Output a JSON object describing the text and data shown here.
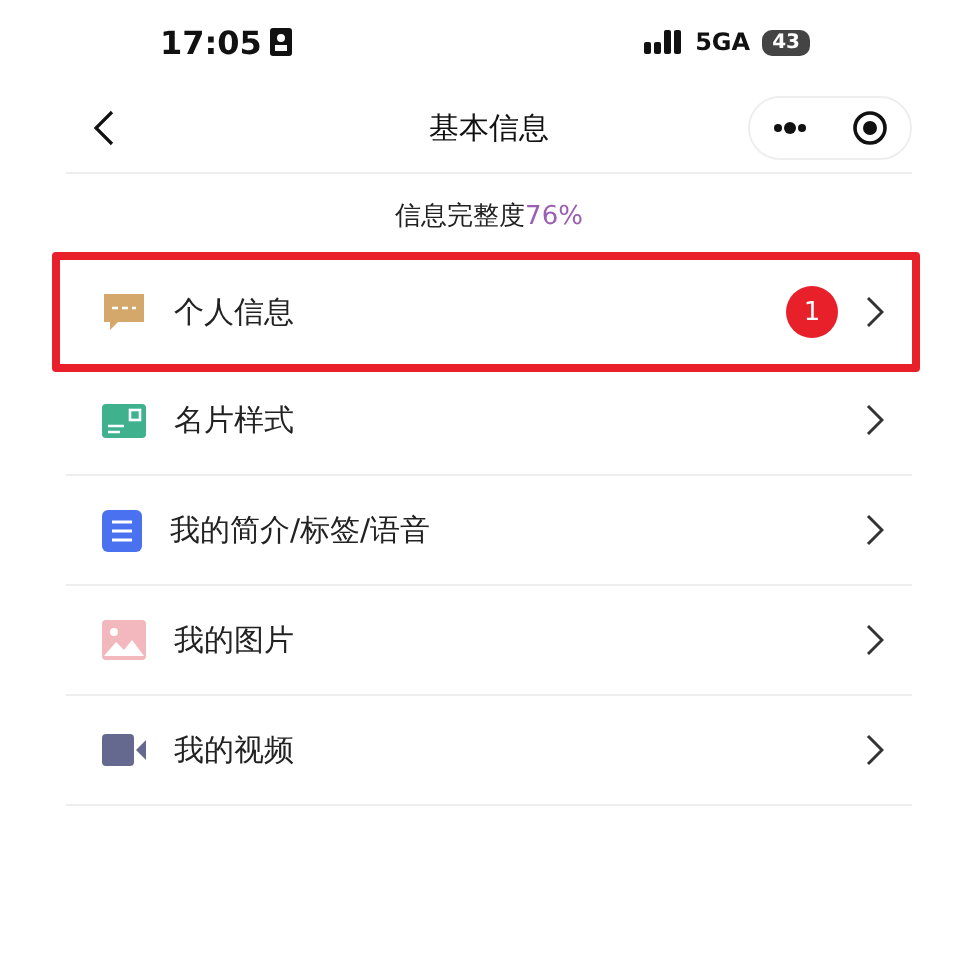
{
  "status_bar": {
    "time": "17:05",
    "network": "5GA",
    "battery": "43"
  },
  "nav": {
    "title": "基本信息"
  },
  "completeness": {
    "label": "信息完整度",
    "value": "76%"
  },
  "items": [
    {
      "kind": "chat",
      "label": "个人信息",
      "badge": "1",
      "highlighted": true
    },
    {
      "kind": "card",
      "label": "名片样式",
      "highlighted": false
    },
    {
      "kind": "doc",
      "label": "我的简介/标签/语音",
      "highlighted": false
    },
    {
      "kind": "image",
      "label": "我的图片",
      "highlighted": false
    },
    {
      "kind": "video",
      "label": "我的视频",
      "highlighted": false
    }
  ]
}
